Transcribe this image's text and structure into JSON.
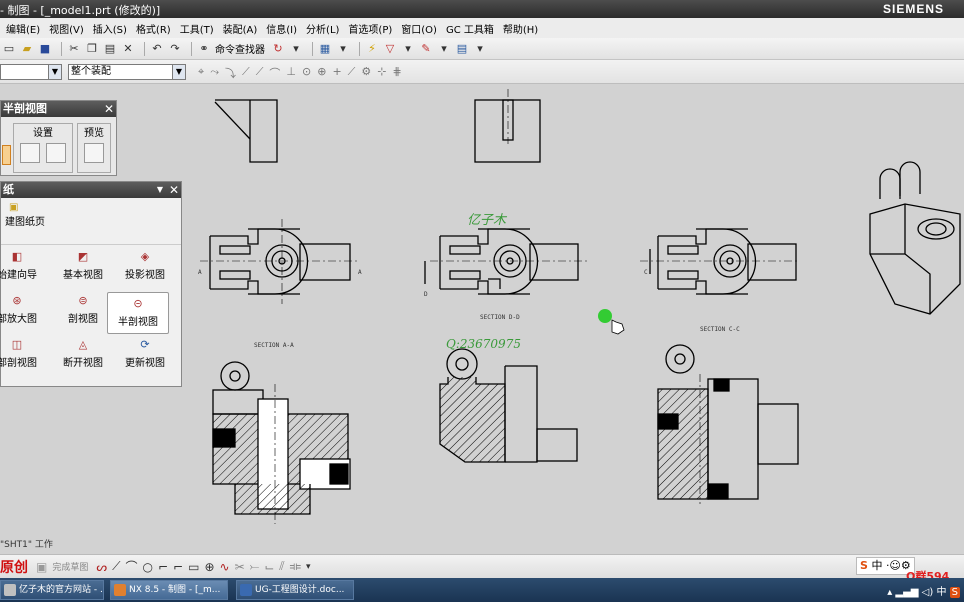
{
  "window": {
    "title": "- 制图 - [_model1.prt (修改的)]",
    "brand": "SIEMENS"
  },
  "menu": [
    "编辑(E)",
    "视图(V)",
    "插入(S)",
    "格式(R)",
    "工具(T)",
    "装配(A)",
    "信息(I)",
    "分析(L)",
    "首选项(P)",
    "窗口(O)",
    "GC 工具箱",
    "帮助(H)"
  ],
  "toolbar": {
    "command_finder": "命令查找器"
  },
  "selection": {
    "assembly_filter": "整个装配"
  },
  "view_panel": {
    "title": "半剖视图",
    "settings": "设置",
    "preview": "预览"
  },
  "drawing_panel": {
    "title": "纸",
    "new_sheet": "建图纸页",
    "items": [
      "始建向导",
      "基本视图",
      "投影视图",
      "部放大图",
      "剖视图",
      "半剖视图",
      "部剖视图",
      "断开视图",
      "更新视图"
    ]
  },
  "drawing": {
    "section_labels": [
      "SECTION A-A",
      "SECTION D-D",
      "SECTION C-C"
    ],
    "label_a": "A",
    "label_d": "D",
    "label_c": "C",
    "watermark_name": "亿子木",
    "watermark_number": "Q:23670975"
  },
  "status": {
    "text": "\"SHT1\" 工作"
  },
  "bottom_toolbar": {
    "original_mark": "原创",
    "finish_sketch": "完成草图"
  },
  "taskbar": {
    "items": [
      "亿子木的官方网站 - ...",
      "NX 8.5 - 制图 - [_m...",
      "UG-工程图设计.doc..."
    ],
    "tray": "中",
    "ime": "中",
    "qq": "Q群594"
  },
  "colors": {
    "accent_green": "#33cc33",
    "watermark": "#3a9a3a"
  }
}
